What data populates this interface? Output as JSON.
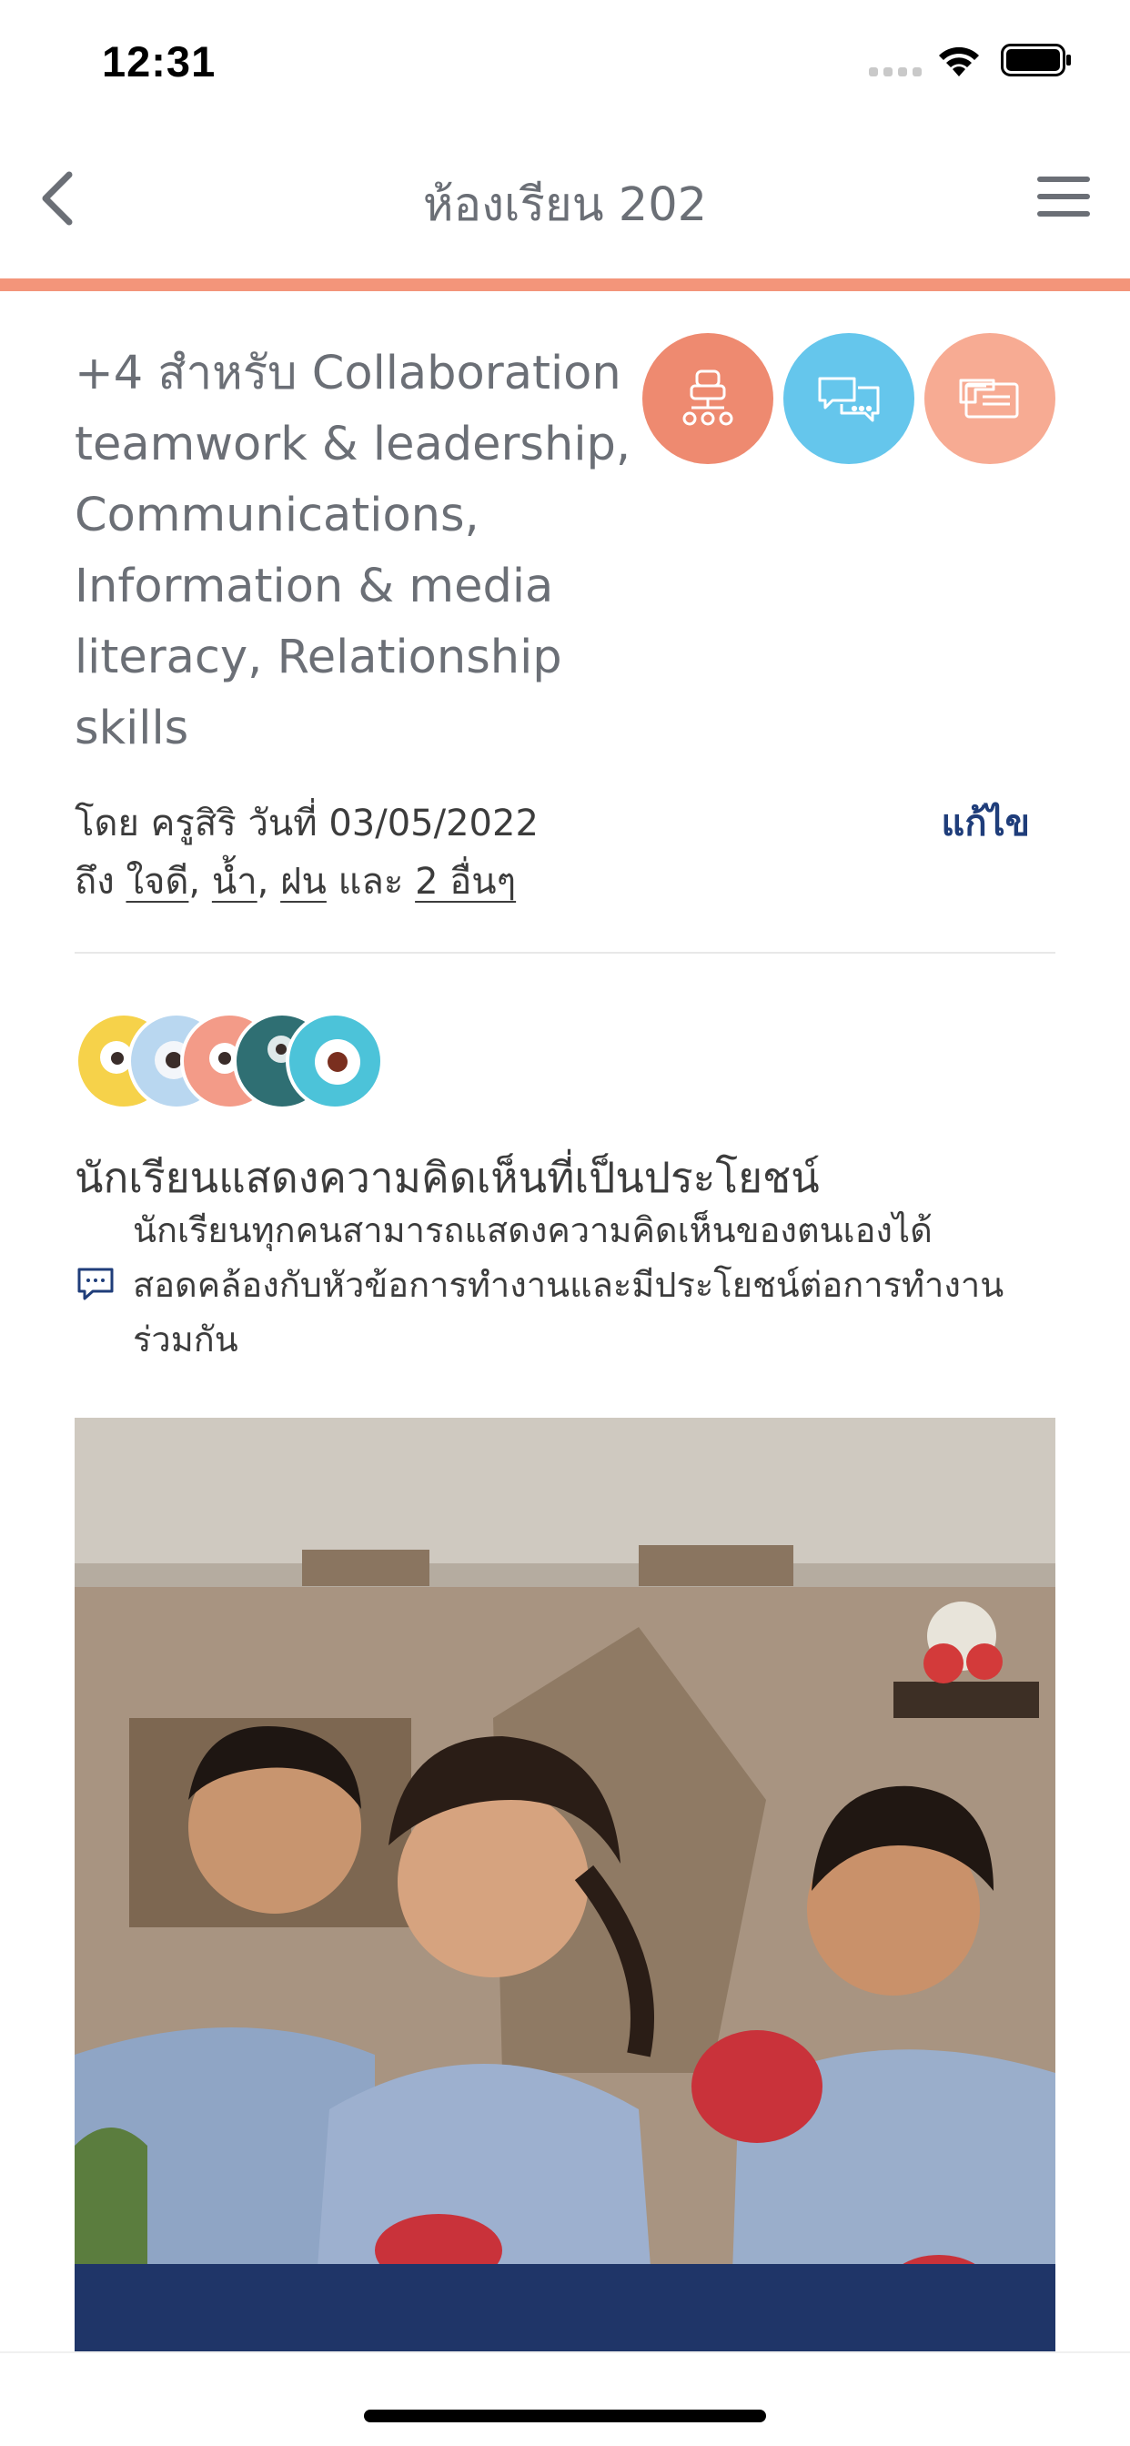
{
  "status_bar": {
    "time": "12:31"
  },
  "nav": {
    "title": "ห้องเรียน 202",
    "back_icon": "chevron-left-icon",
    "menu_icon": "hamburger-menu-icon"
  },
  "post": {
    "title": "+4 สำหรับ Collaboration teamwork & leadership, Communications, Information & media literacy, Relationship skills",
    "categories": [
      {
        "icon": "teamwork-icon",
        "color": "#ee8a70"
      },
      {
        "icon": "chat-bubbles-icon",
        "color": "#65c6ec"
      },
      {
        "icon": "media-literacy-icon",
        "color": "#f7ab93"
      }
    ],
    "author_line": "โดย ครูสิริ วันที่ 03/05/2022",
    "edit_label": "แก้ไข",
    "recipients_prefix": "ถึง",
    "recipients": [
      "ใจดี",
      "น้ำ",
      "ฝน"
    ],
    "recipients_and": "และ",
    "recipients_more": "2 อื่นๆ",
    "comma": ","
  },
  "feedback": {
    "title": "นักเรียนแสดงความคิดเห็นที่เป็นประโยชน์",
    "body": "นักเรียนทุกคนสามารถแสดงความคิดเห็นของตนเองได้สอดคล้องกับหัวข้อการทำงานและมีประโยชน์ต่อการทำงานร่วมกัน"
  },
  "avatars": [
    {
      "name": "yellow-monster-avatar",
      "color": "#f6d24a"
    },
    {
      "name": "blue-monster-avatar",
      "color": "#b9d7f0"
    },
    {
      "name": "pink-monster-avatar",
      "color": "#f39b88"
    },
    {
      "name": "teal-monster-avatar",
      "color": "#2f6f73"
    },
    {
      "name": "cyan-monster-avatar",
      "color": "#4cc3d9"
    }
  ]
}
